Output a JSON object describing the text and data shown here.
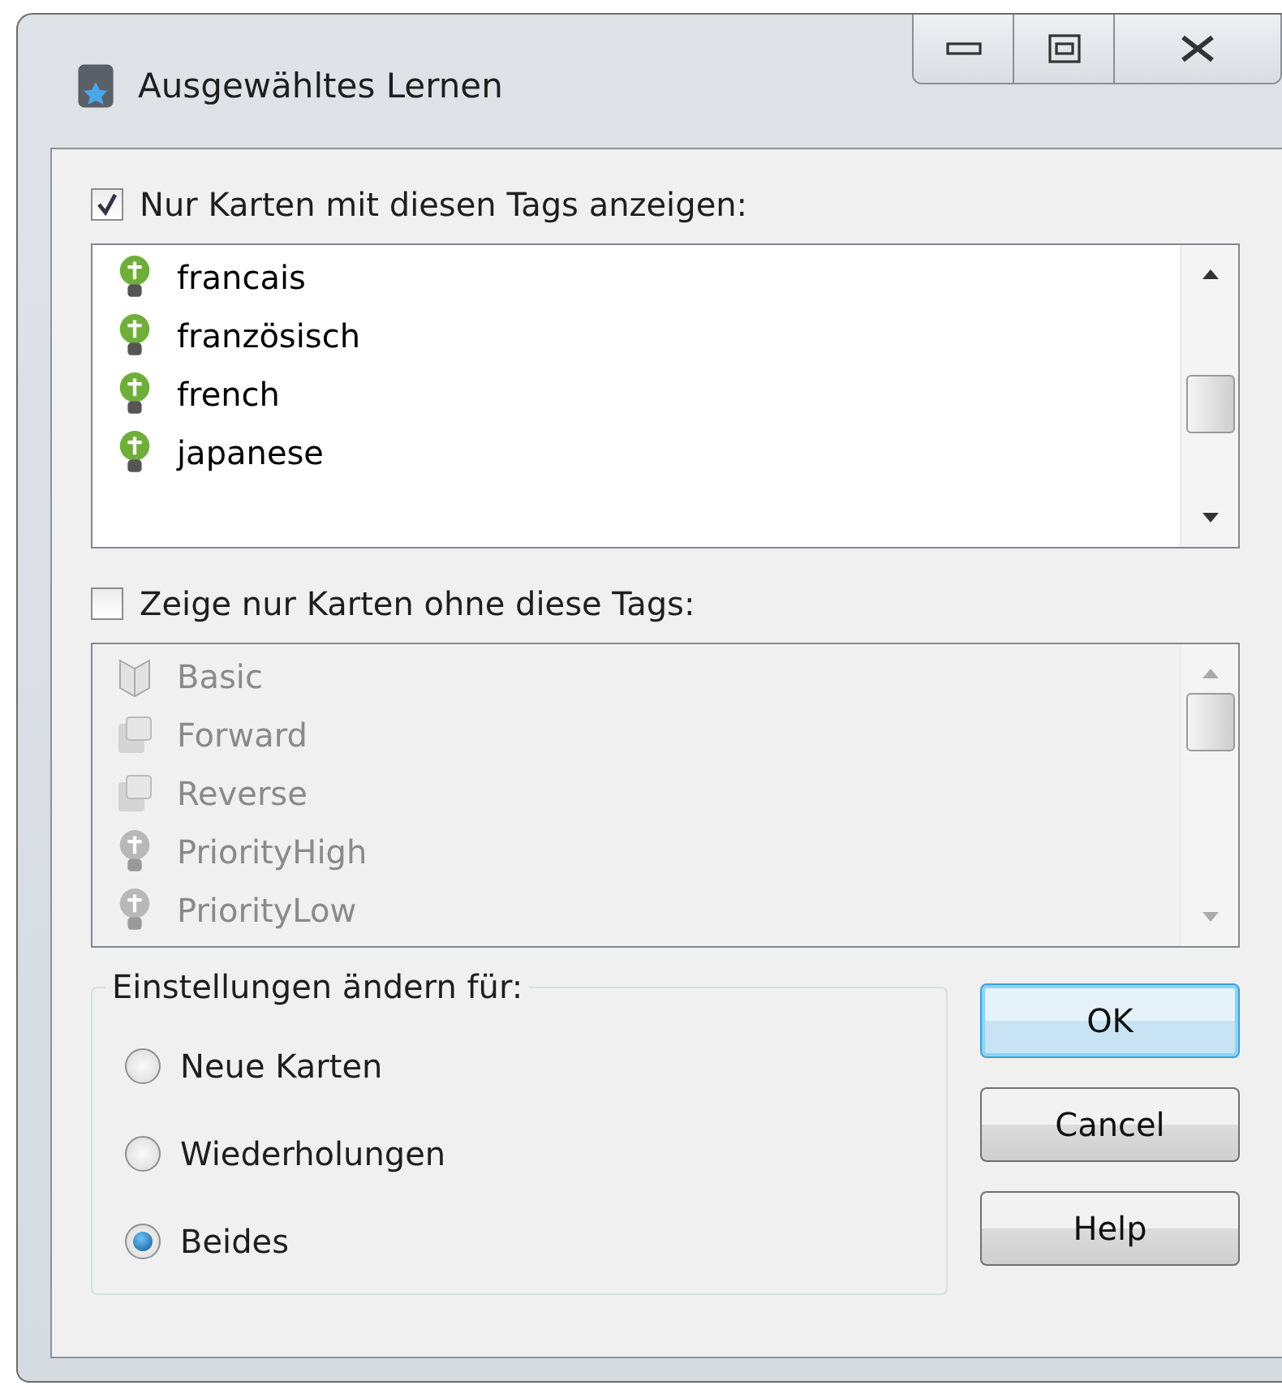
{
  "window": {
    "title": "Ausgewähltes Lernen"
  },
  "include": {
    "label": "Nur Karten mit diesen Tags anzeigen:",
    "checked": true,
    "items": [
      {
        "label": "francais",
        "kind": "tag"
      },
      {
        "label": "französisch",
        "kind": "tag"
      },
      {
        "label": "french",
        "kind": "tag"
      },
      {
        "label": "japanese",
        "kind": "tag"
      }
    ]
  },
  "exclude": {
    "label": "Zeige nur Karten ohne diese Tags:",
    "checked": false,
    "items": [
      {
        "label": "Basic",
        "kind": "model"
      },
      {
        "label": "Forward",
        "kind": "card"
      },
      {
        "label": "Reverse",
        "kind": "card"
      },
      {
        "label": "PriorityHigh",
        "kind": "tag"
      },
      {
        "label": "PriorityLow",
        "kind": "tag"
      }
    ]
  },
  "settings": {
    "title": "Einstellungen ändern für:",
    "options": [
      {
        "label": "Neue Karten",
        "selected": false
      },
      {
        "label": "Wiederholungen",
        "selected": false
      },
      {
        "label": "Beides",
        "selected": true
      }
    ]
  },
  "buttons": [
    {
      "label": "OK",
      "default": true
    },
    {
      "label": "Cancel",
      "default": false
    },
    {
      "label": "Help",
      "default": false
    }
  ]
}
